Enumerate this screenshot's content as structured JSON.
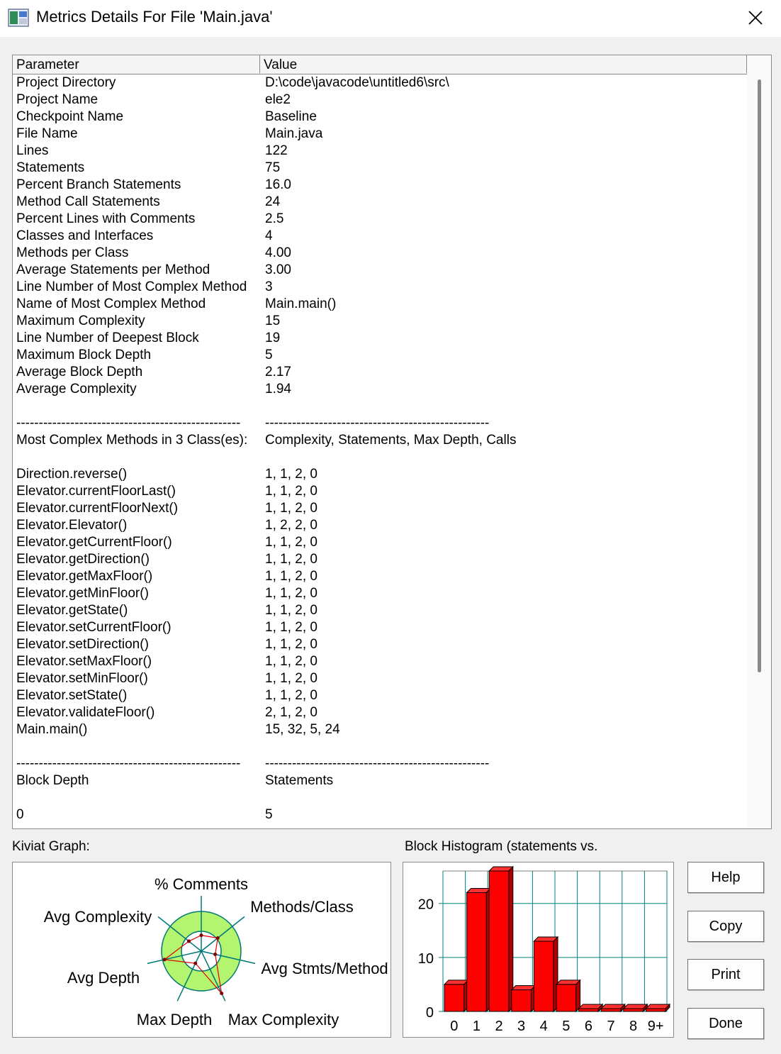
{
  "window": {
    "title": "Metrics Details For File 'Main.java'",
    "app_icon": "window-app-icon",
    "close_icon": "close-icon"
  },
  "table": {
    "col_parameter": "Parameter",
    "col_value": "Value",
    "rows": [
      {
        "p": "Project Directory",
        "v": "D:\\code\\javacode\\untitled6\\src\\"
      },
      {
        "p": "Project Name",
        "v": "ele2"
      },
      {
        "p": "Checkpoint Name",
        "v": "Baseline"
      },
      {
        "p": "File Name",
        "v": "Main.java"
      },
      {
        "p": "Lines",
        "v": "122"
      },
      {
        "p": "Statements",
        "v": "75"
      },
      {
        "p": "Percent Branch Statements",
        "v": "16.0"
      },
      {
        "p": "Method Call Statements",
        "v": "24"
      },
      {
        "p": "Percent Lines with Comments",
        "v": "2.5"
      },
      {
        "p": "Classes and Interfaces",
        "v": "4"
      },
      {
        "p": "Methods per Class",
        "v": "4.00"
      },
      {
        "p": "Average Statements per Method",
        "v": "3.00"
      },
      {
        "p": "Line Number of Most Complex Method",
        "v": "3"
      },
      {
        "p": "Name of Most Complex Method",
        "v": "Main.main()"
      },
      {
        "p": "Maximum Complexity",
        "v": "15"
      },
      {
        "p": "Line Number of Deepest Block",
        "v": "19"
      },
      {
        "p": "Maximum Block Depth",
        "v": "5"
      },
      {
        "p": "Average Block Depth",
        "v": "2.17"
      },
      {
        "p": "Average Complexity",
        "v": "1.94"
      },
      {
        "p": "",
        "v": ""
      },
      {
        "p": "--------------------------------------------------",
        "v": "--------------------------------------------------"
      },
      {
        "p": "Most Complex Methods in 3 Class(es):",
        "v": "Complexity, Statements, Max Depth, Calls"
      },
      {
        "p": "",
        "v": ""
      },
      {
        "p": "Direction.reverse()",
        "v": "1, 1, 2, 0"
      },
      {
        "p": "Elevator.currentFloorLast()",
        "v": "1, 1, 2, 0"
      },
      {
        "p": "Elevator.currentFloorNext()",
        "v": "1, 1, 2, 0"
      },
      {
        "p": "Elevator.Elevator()",
        "v": "1, 2, 2, 0"
      },
      {
        "p": "Elevator.getCurrentFloor()",
        "v": "1, 1, 2, 0"
      },
      {
        "p": "Elevator.getDirection()",
        "v": "1, 1, 2, 0"
      },
      {
        "p": "Elevator.getMaxFloor()",
        "v": "1, 1, 2, 0"
      },
      {
        "p": "Elevator.getMinFloor()",
        "v": "1, 1, 2, 0"
      },
      {
        "p": "Elevator.getState()",
        "v": "1, 1, 2, 0"
      },
      {
        "p": "Elevator.setCurrentFloor()",
        "v": "1, 1, 2, 0"
      },
      {
        "p": "Elevator.setDirection()",
        "v": "1, 1, 2, 0"
      },
      {
        "p": "Elevator.setMaxFloor()",
        "v": "1, 1, 2, 0"
      },
      {
        "p": "Elevator.setMinFloor()",
        "v": "1, 1, 2, 0"
      },
      {
        "p": "Elevator.setState()",
        "v": "1, 1, 2, 0"
      },
      {
        "p": "Elevator.validateFloor()",
        "v": "2, 1, 2, 0"
      },
      {
        "p": "Main.main()",
        "v": "15, 32, 5, 24"
      },
      {
        "p": "",
        "v": ""
      },
      {
        "p": "--------------------------------------------------",
        "v": "--------------------------------------------------"
      },
      {
        "p": "Block Depth",
        "v": "Statements"
      },
      {
        "p": "",
        "v": ""
      },
      {
        "p": "0",
        "v": "5"
      }
    ]
  },
  "kiviat": {
    "label": "Kiviat Graph:",
    "axes": [
      "% Comments",
      "Methods/Class",
      "Avg Stmts/Method",
      "Max Complexity",
      "Max Depth",
      "Avg Depth",
      "Avg Complexity"
    ],
    "ring_color": "#b4f56f",
    "line_color": "#e00000",
    "axis_color": "#007878"
  },
  "histogram": {
    "label": "Block Histogram (statements vs.",
    "bar_color": "#ff0000",
    "grid_color": "#008080"
  },
  "chart_data": {
    "type": "bar",
    "title": "Block Histogram (statements vs.",
    "categories": [
      "0",
      "1",
      "2",
      "3",
      "4",
      "5",
      "6",
      "7",
      "8",
      "9+"
    ],
    "values": [
      5,
      22,
      26,
      4,
      13,
      5,
      0,
      0,
      0,
      0
    ],
    "yticks": [
      "0",
      "10",
      "20"
    ],
    "ylim": [
      0,
      26
    ],
    "grid": true
  },
  "buttons": {
    "help": "Help",
    "copy": "Copy",
    "print": "Print",
    "done": "Done"
  }
}
